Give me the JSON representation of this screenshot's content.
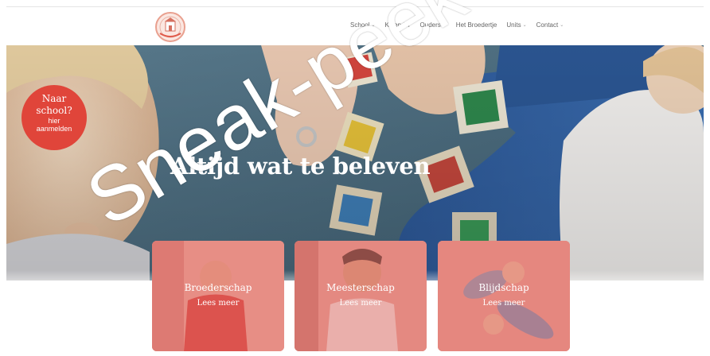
{
  "nav": {
    "items": [
      {
        "label": "School",
        "has_dropdown": true
      },
      {
        "label": "Kalender",
        "has_dropdown": false
      },
      {
        "label": "Ouders",
        "has_dropdown": true
      },
      {
        "label": "Het Broedertje",
        "has_dropdown": false
      },
      {
        "label": "Units",
        "has_dropdown": true
      },
      {
        "label": "Contact",
        "has_dropdown": true
      }
    ],
    "chevron": "⌄"
  },
  "logo": {
    "icon": "school-logo-icon"
  },
  "hero": {
    "title": "Altijd wat te beleven"
  },
  "badge": {
    "line1": "Naar",
    "line2": "school?",
    "line3": "hier",
    "line4": "aanmelden"
  },
  "cards": [
    {
      "title": "Broederschap",
      "link": "Lees meer"
    },
    {
      "title": "Meesterschap",
      "link": "Lees meer"
    },
    {
      "title": "Blijdschap",
      "link": "Lees meer"
    }
  ],
  "watermark": "Sneak-peek",
  "colors": {
    "accent": "#e0453a",
    "card_overlay": "#e06e68",
    "nav_text": "#666666"
  }
}
